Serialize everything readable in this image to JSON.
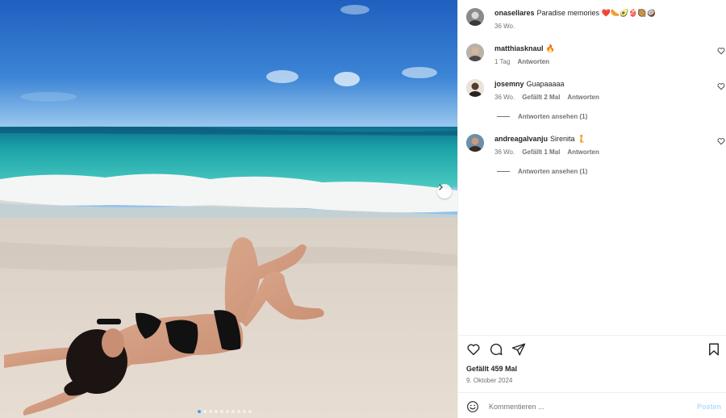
{
  "post": {
    "caption_user": "onasellares",
    "caption_text": "Paradise memories",
    "caption_emojis": "❤️🌭🥑👙🥘🥥",
    "caption_age": "36 Wo."
  },
  "comments": [
    {
      "user": "matthiasknaul",
      "text": "",
      "emoji": "🔥",
      "age": "1 Tag",
      "likes": "",
      "reply_label": "Antworten",
      "view_replies": ""
    },
    {
      "user": "josemny",
      "text": "Guapaaaaa",
      "emoji": "",
      "age": "36 Wo.",
      "likes": "Gefällt 2 Mal",
      "reply_label": "Antworten",
      "view_replies": "Antworten ansehen (1)"
    },
    {
      "user": "andreagalvanju",
      "text": "Sirenita",
      "emoji": "🧜",
      "age": "36 Wo.",
      "likes": "Gefällt 1 Mal",
      "reply_label": "Antworten",
      "view_replies": "Antworten ansehen (1)"
    }
  ],
  "footer": {
    "likes": "Gefällt 459 Mal",
    "date": "9. Oktober 2024",
    "comment_placeholder": "Kommentieren ...",
    "post_label": "Posten"
  },
  "carousel": {
    "slide_count": 10,
    "active_index": 0
  },
  "icons": {
    "like": "heart-icon",
    "comment": "comment-icon",
    "share": "share-icon",
    "save": "bookmark-icon",
    "emoji": "smiley-icon",
    "next": "chevron-right-icon"
  },
  "colors": {
    "accent": "#0095f6",
    "post_disabled": "#b3dbff",
    "text": "#262626",
    "muted": "#737373"
  }
}
